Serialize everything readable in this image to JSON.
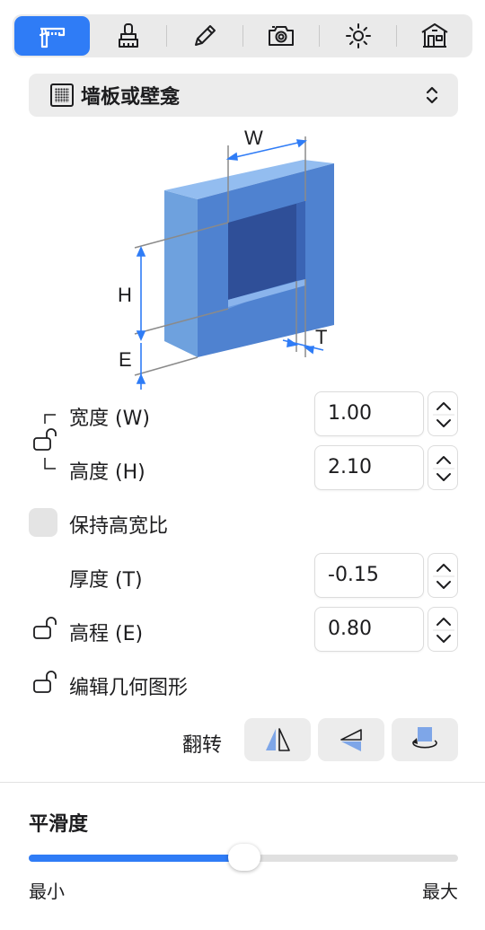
{
  "toolbar": {
    "tabs": [
      {
        "icon": "caliper-icon",
        "active": true
      },
      {
        "icon": "paint-brush-icon",
        "active": false
      },
      {
        "icon": "pencil-icon",
        "active": false
      },
      {
        "icon": "camera-icon",
        "active": false
      },
      {
        "icon": "sun-icon",
        "active": false
      },
      {
        "icon": "house-icon",
        "active": false
      }
    ]
  },
  "object_type": {
    "selected": "墙板或壁龛",
    "icon": "wall-panel-icon"
  },
  "diagram": {
    "labels": {
      "w": "W",
      "h": "H",
      "t": "T",
      "e": "E"
    },
    "colors": {
      "front": "#5b8ed8",
      "side": "#4a7cc8",
      "top": "#8fb8ec",
      "inner": "#2e4f9a",
      "dim": "#2f7cf6"
    }
  },
  "fields": {
    "width": {
      "label": "宽度 (W)",
      "value": "1.00"
    },
    "height": {
      "label": "高度 (H)",
      "value": "2.10"
    },
    "keep_ratio": {
      "label": "保持高宽比",
      "checked": false
    },
    "thickness": {
      "label": "厚度 (T)",
      "value": "-0.15"
    },
    "elevation": {
      "label": "高程 (E)",
      "value": "0.80"
    },
    "edit_geometry": {
      "label": "编辑几何图形"
    }
  },
  "flip": {
    "label": "翻转",
    "buttons": [
      "flip-horizontal-icon",
      "flip-vertical-icon",
      "rotate-icon"
    ]
  },
  "smoothness": {
    "title": "平滑度",
    "min_label": "最小",
    "max_label": "最大",
    "value_fraction": 0.5,
    "accent": "#2f7cf6"
  }
}
